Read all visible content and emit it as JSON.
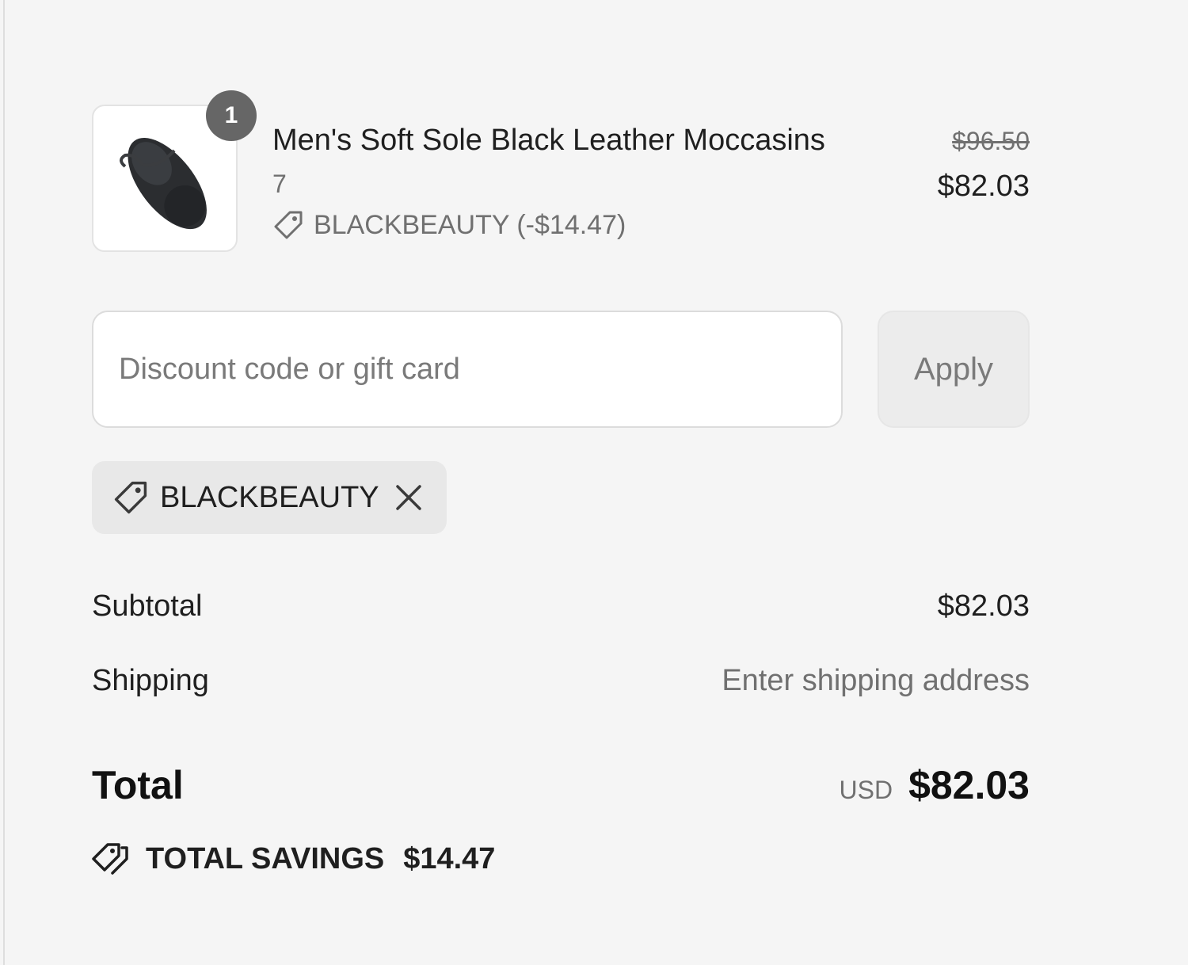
{
  "line_item": {
    "quantity": "1",
    "title": "Men's Soft Sole Black Leather Moccasins",
    "variant": "7",
    "discount_text": "BLACKBEAUTY (-$14.47)",
    "original_price": "$96.50",
    "price": "$82.03",
    "image": "black-moccasin-image"
  },
  "discount": {
    "placeholder": "Discount code or gift card",
    "value": "",
    "apply_label": "Apply"
  },
  "applied_code": {
    "code": "BLACKBEAUTY",
    "tag_icon": "tag-icon",
    "remove_icon": "close-icon"
  },
  "totals": {
    "subtotal_label": "Subtotal",
    "subtotal_value": "$82.03",
    "shipping_label": "Shipping",
    "shipping_value": "Enter shipping address",
    "total_label": "Total",
    "currency": "USD",
    "total_value": "$82.03",
    "savings_label": "TOTAL SAVINGS",
    "savings_value": "$14.47",
    "savings_icon": "tags-icon"
  },
  "colors": {
    "background": "#f5f5f5",
    "badge": "#666666",
    "muted_text": "#707070",
    "chip": "#e8e8e8"
  }
}
